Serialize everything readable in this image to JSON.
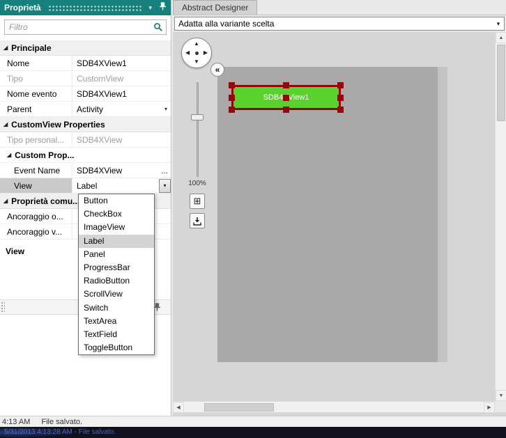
{
  "colors": {
    "header_teal": "#16807c",
    "view_green": "#5ad22e",
    "handle_red": "#8e0b0b",
    "canvas_gray": "#a9a9a9"
  },
  "icons": {
    "arrow_up": "▲",
    "arrow_down": "▼",
    "arrow_left": "◀",
    "arrow_right": "▶",
    "chevron_down": "▾",
    "expand_triangle": "◢",
    "collapse_chevrons": "«",
    "fit_screen": "⊞",
    "ellipsis": "..."
  },
  "properties_panel": {
    "title": "Proprietà",
    "filter_placeholder": "Filtro",
    "rows": [
      {
        "label": "Principale",
        "value": ""
      },
      {
        "label": "Nome",
        "value": "SDB4XView1"
      },
      {
        "label": "Tipo",
        "value": "CustomView"
      },
      {
        "label": "Nome evento",
        "value": "SDB4XView1"
      },
      {
        "label": "Parent",
        "value": "Activity"
      },
      {
        "label": "CustomView Properties",
        "value": ""
      },
      {
        "label": "Tipo personal...",
        "value": "SDB4XView"
      },
      {
        "label": "Custom Prop...",
        "value": ""
      },
      {
        "label": "Event Name",
        "value": "SDB4XView"
      },
      {
        "label": "View",
        "value": "Label"
      },
      {
        "label": "Proprietà comu...",
        "value": ""
      },
      {
        "label": "Ancoraggio o...",
        "value": ""
      },
      {
        "label": "Ancoraggio v...",
        "value": ""
      }
    ],
    "description_title": "View",
    "dropdown": {
      "selected": "Label",
      "items": [
        "Button",
        "CheckBox",
        "ImageView",
        "Label",
        "Panel",
        "ProgressBar",
        "RadioButton",
        "ScrollView",
        "Switch",
        "TextArea",
        "TextField",
        "ToggleButton"
      ]
    }
  },
  "designer": {
    "tab_label": "Abstract Designer",
    "variant_selector": "Adatta alla variante scelta",
    "zoom_level": "100%",
    "selected_view_label": "SDB4XView1"
  },
  "status_bar": {
    "time": "4:13 AM",
    "message": "File salvato."
  },
  "taskbar_log": "5/31/2013 4:13:28 AM - File salvato."
}
